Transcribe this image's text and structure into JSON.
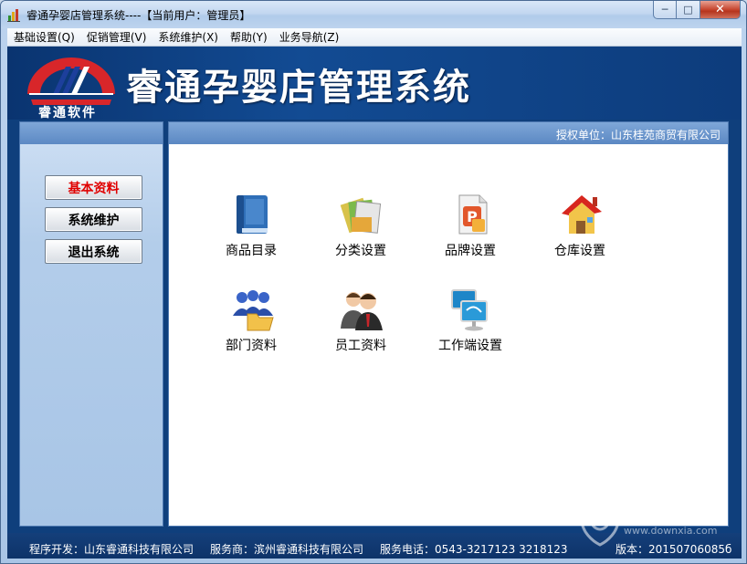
{
  "window": {
    "title": "睿通孕婴店管理系统----【当前用户：管理员】",
    "minimize": "─",
    "maximize": "□",
    "close": "✕"
  },
  "menu": [
    {
      "label": "基础设置(Q)"
    },
    {
      "label": "促销管理(V)"
    },
    {
      "label": "系统维护(X)"
    },
    {
      "label": "帮助(Y)"
    },
    {
      "label": "业务导航(Z)"
    }
  ],
  "banner": {
    "logo_text": "睿通软件",
    "title": "睿通孕婴店管理系统"
  },
  "left_nav": [
    {
      "label": "基本资料",
      "active": true
    },
    {
      "label": "系统维护"
    },
    {
      "label": "退出系统"
    }
  ],
  "right_header": {
    "auth": "授权单位：山东桂苑商贸有限公司"
  },
  "tiles": [
    {
      "label": "商品目录",
      "icon": "book-icon"
    },
    {
      "label": "分类设置",
      "icon": "folders-icon"
    },
    {
      "label": "品牌设置",
      "icon": "brand-doc-icon"
    },
    {
      "label": "仓库设置",
      "icon": "warehouse-house-icon"
    },
    {
      "label": "部门资料",
      "icon": "department-folder-icon"
    },
    {
      "label": "员工资料",
      "icon": "employees-icon"
    },
    {
      "label": "工作端设置",
      "icon": "workstations-icon"
    }
  ],
  "status": {
    "developer": "程序开发：山东睿通科技有限公司",
    "service": "服务商：滨州睿通科技有限公司",
    "phone": "服务电话：0543-3217123 3218123",
    "version": "版本：20150706085б"
  },
  "watermark": {
    "text": "当下软件园",
    "url": "www.downxia.com"
  },
  "colors": {
    "banner": "#124b93",
    "panel_header": "#6e9bd1",
    "active_nav": "#e00000"
  }
}
